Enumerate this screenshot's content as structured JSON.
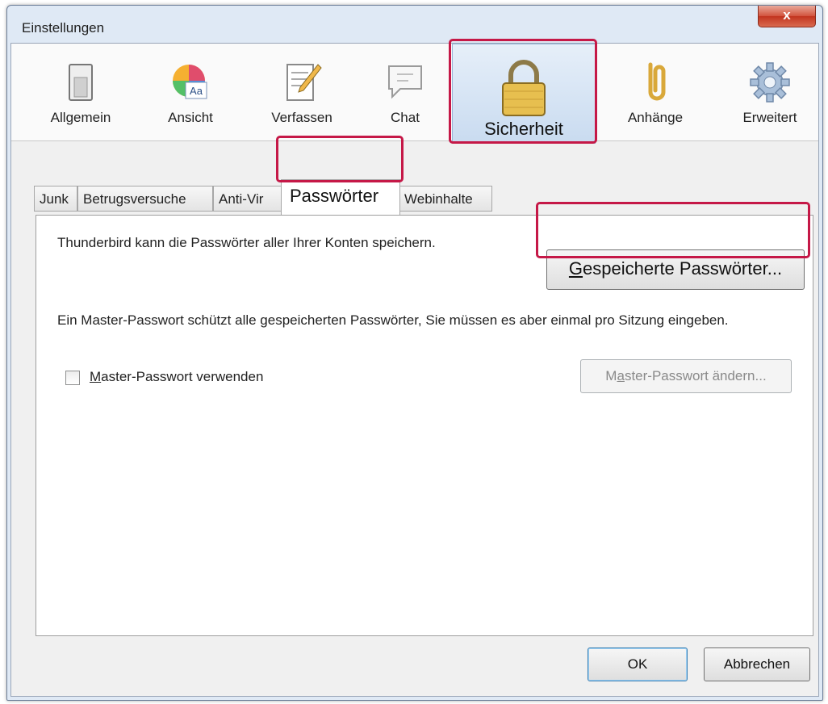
{
  "window": {
    "title": "Einstellungen",
    "close_symbol": "x"
  },
  "toolbar": {
    "items": [
      {
        "label": "Allgemein",
        "icon": "switch-icon"
      },
      {
        "label": "Ansicht",
        "icon": "color-wheel-icon",
        "icon_text": "Aa"
      },
      {
        "label": "Verfassen",
        "icon": "compose-icon"
      },
      {
        "label": "Chat",
        "icon": "chat-icon"
      },
      {
        "label": "Sicherheit",
        "icon": "padlock-icon",
        "selected": true
      },
      {
        "label": "Anhänge",
        "icon": "paperclip-icon"
      },
      {
        "label": "Erweitert",
        "icon": "gear-icon"
      }
    ]
  },
  "tabs": [
    "Junk",
    "Betrugsversuche",
    "Anti-Vir",
    "Passwörter",
    "Webinhalte"
  ],
  "active_tab": "Passwörter",
  "content": {
    "passwords_text": "Thunderbird kann die Passwörter aller Ihrer Konten speichern.",
    "saved_passwords_button": {
      "underlined": "G",
      "rest": "espeicherte Passwörter..."
    },
    "master_text": "Ein Master-Passwort schützt alle gespeicherten Passwörter, Sie müssen es aber einmal pro Sitzung eingeben.",
    "master_checkbox": {
      "underlined": "M",
      "rest": "aster-Passwort verwenden",
      "checked": false
    },
    "change_master_button": {
      "pre": "M",
      "underlined": "a",
      "rest": "ster-Passwort ändern..."
    }
  },
  "footer": {
    "ok_label": "OK",
    "cancel_label": "Abbrechen"
  },
  "colors": {
    "highlight": "#c51847",
    "accent": "#95b4d8"
  }
}
